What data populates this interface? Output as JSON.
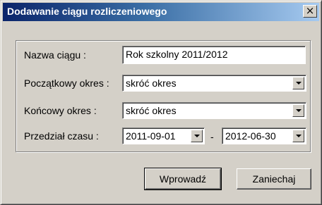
{
  "dialog": {
    "title": "Dodawanie ciągu rozliczeniowego",
    "close_symbol": "×"
  },
  "form": {
    "name_label": "Nazwa ciągu :",
    "name_value": "Rok szkolny 2011/2012",
    "start_label": "Początkowy okres :",
    "start_value": "skróć okres",
    "end_label": "Końcowy okres :",
    "end_value": "skróć okres",
    "range_label": "Przedział czasu :",
    "date_from": "2011-09-01",
    "range_separator": "-",
    "date_to": "2012-06-30"
  },
  "buttons": {
    "ok_label": "Wprowadź",
    "cancel_label": "Zaniechaj"
  }
}
